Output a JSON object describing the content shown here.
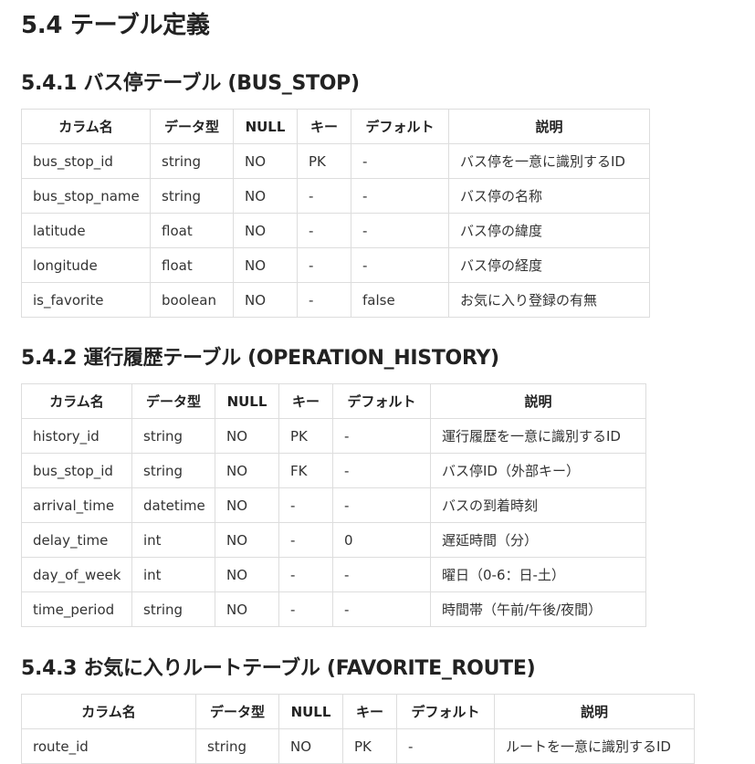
{
  "title": "5.4 テーブル定義",
  "sections": [
    {
      "heading": "5.4.1 バス停テーブル (BUS_STOP)",
      "columns": [
        "カラム名",
        "データ型",
        "NULL",
        "キー",
        "デフォルト",
        "説明"
      ],
      "rows": [
        [
          "bus_stop_id",
          "string",
          "NO",
          "PK",
          "-",
          "バス停を一意に識別するID"
        ],
        [
          "bus_stop_name",
          "string",
          "NO",
          "-",
          "-",
          "バス停の名称"
        ],
        [
          "latitude",
          "float",
          "NO",
          "-",
          "-",
          "バス停の緯度"
        ],
        [
          "longitude",
          "float",
          "NO",
          "-",
          "-",
          "バス停の経度"
        ],
        [
          "is_favorite",
          "boolean",
          "NO",
          "-",
          "false",
          "お気に入り登録の有無"
        ]
      ]
    },
    {
      "heading": "5.4.2 運行履歴テーブル (OPERATION_HISTORY)",
      "columns": [
        "カラム名",
        "データ型",
        "NULL",
        "キー",
        "デフォルト",
        "説明"
      ],
      "rows": [
        [
          "history_id",
          "string",
          "NO",
          "PK",
          "-",
          "運行履歴を一意に識別するID"
        ],
        [
          "bus_stop_id",
          "string",
          "NO",
          "FK",
          "-",
          "バス停ID（外部キー）"
        ],
        [
          "arrival_time",
          "datetime",
          "NO",
          "-",
          "-",
          "バスの到着時刻"
        ],
        [
          "delay_time",
          "int",
          "NO",
          "-",
          "0",
          "遅延時間（分）"
        ],
        [
          "day_of_week",
          "int",
          "NO",
          "-",
          "-",
          "曜日（0-6：日-土）"
        ],
        [
          "time_period",
          "string",
          "NO",
          "-",
          "-",
          "時間帯（午前/午後/夜間）"
        ]
      ]
    },
    {
      "heading": "5.4.3 お気に入りルートテーブル (FAVORITE_ROUTE)",
      "columns": [
        "カラム名",
        "データ型",
        "NULL",
        "キー",
        "デフォルト",
        "説明"
      ],
      "rows": [
        [
          "route_id",
          "string",
          "NO",
          "PK",
          "-",
          "ルートを一意に識別するID"
        ]
      ]
    }
  ]
}
